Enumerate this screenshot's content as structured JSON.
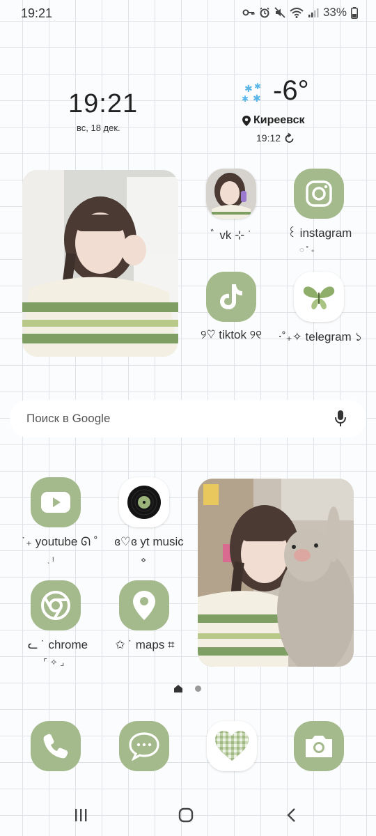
{
  "status_bar": {
    "time": "19:21",
    "battery": "33%"
  },
  "clock_widget": {
    "time": "19:21",
    "date": "вс, 18 дек."
  },
  "weather_widget": {
    "temperature": "-6°",
    "location": "Киреевск",
    "updated": "19:12"
  },
  "apps": {
    "vk": {
      "label": "ﾞ vk ⊹ ˙",
      "deco": ""
    },
    "instagram": {
      "label": "꒰ instagram",
      "deco": "◌ ˚ ₊"
    },
    "tiktok": {
      "label": "୨♡ tiktok ୨୧"
    },
    "telegram": {
      "label": "⋅˚₊✧ telegram ১"
    },
    "youtube": {
      "label": "˙₊ youtube ᘏ ˚",
      "deco": "ˎ !"
    },
    "yt_music": {
      "label": "ɞ♡ɞ yt music",
      "deco": "⋄"
    },
    "chrome": {
      "label": "ᓚ ˙ chrome",
      "deco": "⌜ ✧ ⌟"
    },
    "maps": {
      "label": "✩ ˙ maps ⌗"
    }
  },
  "search": {
    "placeholder": "Поиск в Google"
  },
  "pager": {
    "pages": 2,
    "current": 1
  },
  "dock": [
    "phone",
    "messages",
    "gallery",
    "camera"
  ],
  "colors": {
    "icon_green": "#a5ba8c",
    "background": "#fbfcfd",
    "grid": "#dfe3e8"
  }
}
